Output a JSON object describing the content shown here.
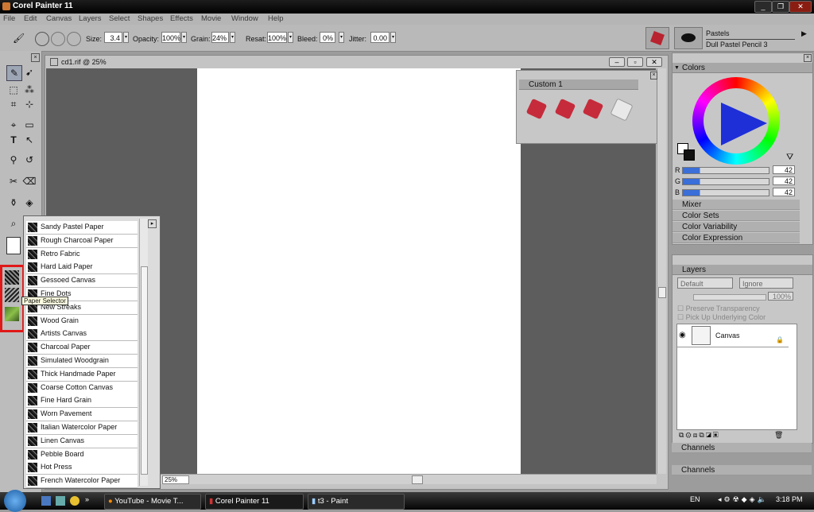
{
  "app": {
    "title": "Corel Painter 11"
  },
  "menu": [
    "File",
    "Edit",
    "Canvas",
    "Layers",
    "Select",
    "Shapes",
    "Effects",
    "Movie",
    "Window",
    "Help"
  ],
  "propbar": {
    "size_label": "Size:",
    "size_value": "3.4",
    "opacity_label": "Opacity:",
    "opacity_value": "100%",
    "grain_label": "Grain:",
    "grain_value": "24%",
    "resat_label": "Resat:",
    "resat_value": "100%",
    "bleed_label": "Bleed:",
    "bleed_value": "0%",
    "jitter_label": "Jitter:",
    "jitter_value": "0.00",
    "brush_category": "Pastels",
    "brush_variant": "Dull Pastel Pencil 3"
  },
  "document": {
    "title": "cd1.rif @ 25%",
    "zoom": "25%"
  },
  "custom_palette": {
    "title": "Custom  1"
  },
  "colors": {
    "title": "Colors",
    "r": "42",
    "g": "42",
    "b": "42",
    "r_label": "R",
    "g_label": "G",
    "b_label": "B"
  },
  "collapsed_panels": [
    "Mixer",
    "Color Sets",
    "Color Variability",
    "Color Expression"
  ],
  "layers": {
    "title": "Layers",
    "composite": "Default",
    "ignore": "Ignore",
    "opacity": "100%",
    "preserve": "Preserve Transparency",
    "pickup": "Pick Up Underlying Color",
    "layer_name": "Canvas"
  },
  "channels": [
    "Channels",
    "Channels"
  ],
  "paper_tooltip": "Paper Selector",
  "papers": [
    "Sandy Pastel Paper",
    "Rough Charcoal Paper",
    "Retro Fabric",
    "Hard Laid Paper",
    "Gessoed Canvas",
    "Fine Dots",
    "New Streaks",
    "Wood Grain",
    "Artists Canvas",
    "Charcoal Paper",
    "Simulated Woodgrain",
    "Thick Handmade Paper",
    "Coarse Cotton Canvas",
    "Fine Hard Grain",
    "Worn Pavement",
    "Italian Watercolor Paper",
    "Linen Canvas",
    "Pebble Board",
    "Hot Press",
    "French Watercolor Paper"
  ],
  "taskbar": {
    "tasks": [
      "YouTube - Movie T...",
      "Corel Painter 11",
      "t3 - Paint"
    ],
    "lang": "EN",
    "time": "3:18 PM"
  },
  "accent": {
    "highlight": "#e01818",
    "wheel_blue": "#1e2fd8"
  }
}
